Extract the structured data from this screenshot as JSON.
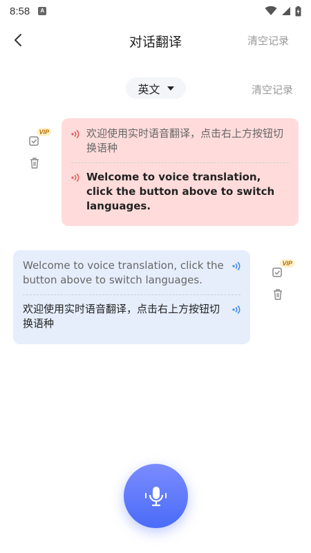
{
  "status": {
    "time": "8:58",
    "app_icon_letter": "A"
  },
  "header": {
    "title": "对话翻译",
    "clear_label": "清空记录"
  },
  "controls": {
    "language": "英文",
    "clear_label": "清空记录"
  },
  "messages": [
    {
      "side": "right",
      "source_text": "欢迎使用实时语音翻译，点击右上方按钮切换语种",
      "translated_text": "Welcome to voice translation, click the button above to switch languages.",
      "vip_badge": "VIP"
    },
    {
      "side": "left",
      "source_text": "Welcome to voice translation, click the button above to switch languages.",
      "translated_text": "欢迎使用实时语音翻译，点击右上方按钮切换语种",
      "vip_badge": "VIP"
    }
  ],
  "colors": {
    "pink_bubble": "#ffdcdb",
    "blue_bubble": "#e6eefc",
    "accent": "#4a6cf7"
  },
  "icons": {
    "back": "chevron-left-icon",
    "dropdown": "caret-down-icon",
    "speaker_red": "speaker-wave-icon",
    "speaker_blue": "speaker-wave-icon",
    "copy": "copy-check-icon",
    "delete": "trash-icon",
    "mic": "microphone-icon"
  }
}
